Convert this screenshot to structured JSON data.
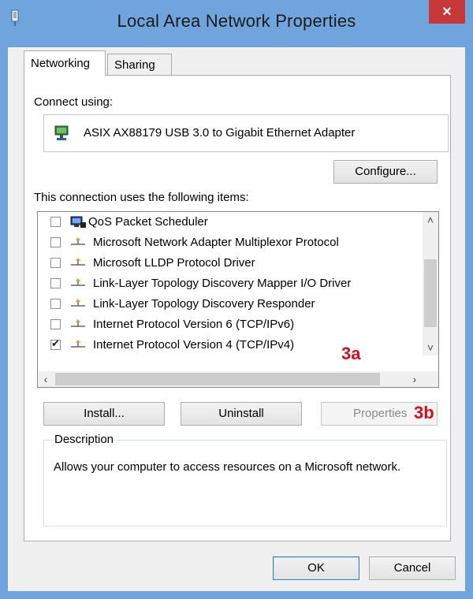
{
  "window": {
    "title": "Local Area Network Properties",
    "close_glyph": "×"
  },
  "tabs": [
    {
      "label": "Networking",
      "selected": true
    },
    {
      "label": "Sharing",
      "selected": false
    }
  ],
  "connect_using": {
    "label": "Connect using:",
    "adapter": "ASIX AX88179 USB 3.0 to Gigabit Ethernet Adapter",
    "icon": "network-adapter-icon"
  },
  "configure_button": "Configure...",
  "items_label": "This connection uses the following items:",
  "items": [
    {
      "label": "QoS Packet Scheduler",
      "checked": false,
      "icon": "qos-scheduler-icon"
    },
    {
      "label": "Microsoft Network Adapter Multiplexor Protocol",
      "checked": false,
      "icon": "protocol-icon"
    },
    {
      "label": "Microsoft LLDP Protocol Driver",
      "checked": false,
      "icon": "protocol-icon"
    },
    {
      "label": "Link-Layer Topology Discovery Mapper I/O Driver",
      "checked": false,
      "icon": "protocol-icon"
    },
    {
      "label": "Link-Layer Topology Discovery Responder",
      "checked": false,
      "icon": "protocol-icon"
    },
    {
      "label": "Internet Protocol Version 6 (TCP/IPv6)",
      "checked": false,
      "icon": "protocol-icon"
    },
    {
      "label": "Internet Protocol Version 4 (TCP/IPv4)",
      "checked": true,
      "icon": "protocol-icon"
    }
  ],
  "callouts": {
    "a": "3a",
    "b": "3b"
  },
  "buttons": {
    "install": "Install...",
    "uninstall": "Uninstall",
    "properties": "Properties",
    "ok": "OK",
    "cancel": "Cancel"
  },
  "description": {
    "legend": "Description",
    "text": "Allows your computer to access resources on a Microsoft network."
  },
  "colors": {
    "titlebar": "#6fa5dc",
    "close_button": "#c7383b",
    "callout_red": "#d1101d"
  }
}
